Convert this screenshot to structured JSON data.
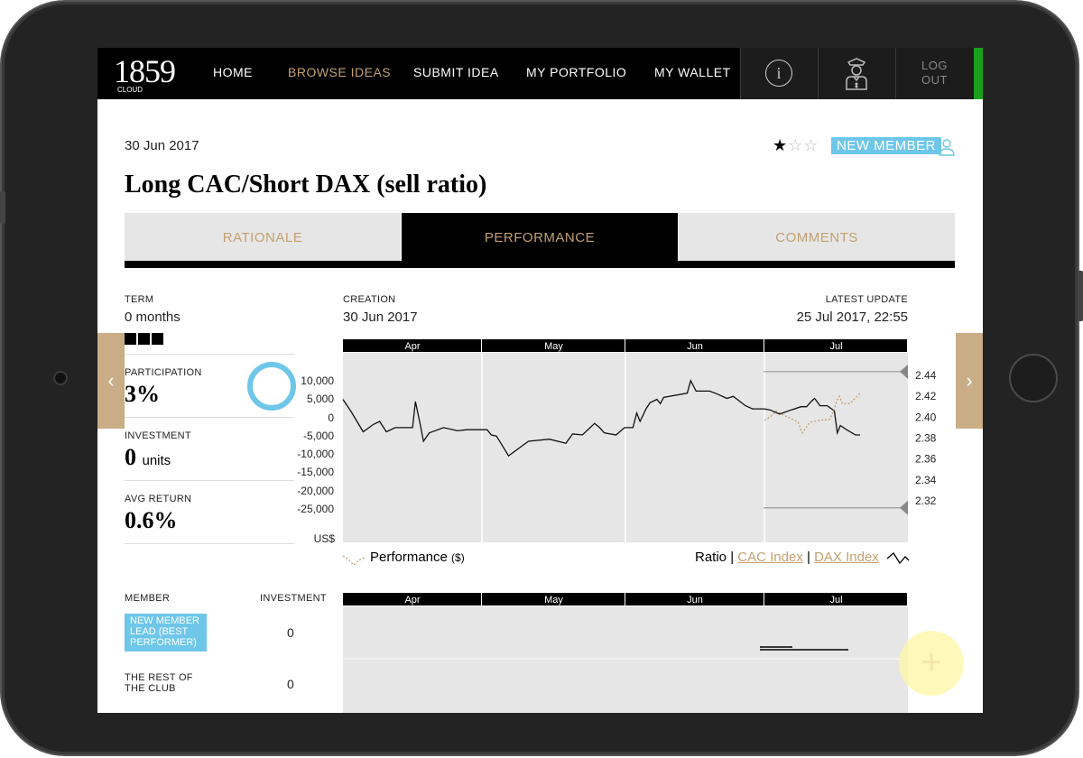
{
  "nav": {
    "logo_number": "1859",
    "logo_sub": "CLOUD",
    "links": [
      "HOME",
      "BROWSE IDEAS",
      "SUBMIT IDEA",
      "MY PORTFOLIO",
      "MY WALLET"
    ],
    "active_link": "BROWSE IDEAS",
    "info_glyph": "i",
    "logout_line1": "LOG",
    "logout_line2": "OUT"
  },
  "header": {
    "date": "30 Jun 2017",
    "title": "Long CAC/Short DAX (sell ratio)",
    "rating": 1,
    "rating_max": 3,
    "badge": "NEW MEMBER"
  },
  "tabs": {
    "items": [
      "RATIONALE",
      "PERFORMANCE",
      "COMMENTS"
    ],
    "active": "PERFORMANCE"
  },
  "stats": {
    "term_label": "TERM",
    "term_value": "0 months",
    "participation_label": "PARTICIPATION",
    "participation_value": "3%",
    "participation_fraction": 0.03,
    "investment_label": "INVESTMENT",
    "investment_value": "0",
    "investment_units": "units",
    "avg_return_label": "AVG RETURN",
    "avg_return_value": "0.6%"
  },
  "chart_info": {
    "creation_label": "CREATION",
    "creation_value": "30 Jun 2017",
    "update_label": "LATEST UPDATE",
    "update_value": "25 Jul 2017, 22:55"
  },
  "chart_data": {
    "type": "line",
    "months": [
      "Apr",
      "May",
      "Jun",
      "Jul"
    ],
    "left_ticks": [
      "10,000",
      "5,000",
      "0",
      "-5,000",
      "-10,000",
      "-15,000",
      "-20,000",
      "-25,000"
    ],
    "left_unit": "US$",
    "right_ticks": [
      "2.44",
      "2.42",
      "2.40",
      "2.38",
      "2.36",
      "2.34",
      "2.32"
    ],
    "ratio_series": [
      [
        0.0,
        2.417
      ],
      [
        0.02,
        2.405
      ],
      [
        0.048,
        2.386
      ],
      [
        0.072,
        2.393
      ],
      [
        0.087,
        2.396
      ],
      [
        0.103,
        2.386
      ],
      [
        0.124,
        2.39
      ],
      [
        0.144,
        2.39
      ],
      [
        0.154,
        2.39
      ],
      [
        0.165,
        2.39
      ],
      [
        0.172,
        2.415
      ],
      [
        0.184,
        2.392
      ],
      [
        0.191,
        2.377
      ],
      [
        0.205,
        2.385
      ],
      [
        0.239,
        2.39
      ],
      [
        0.272,
        2.387
      ],
      [
        0.293,
        2.388
      ],
      [
        0.342,
        2.388
      ],
      [
        0.352,
        2.383
      ],
      [
        0.364,
        2.382
      ],
      [
        0.375,
        2.375
      ],
      [
        0.393,
        2.363
      ],
      [
        0.44,
        2.377
      ],
      [
        0.49,
        2.379
      ],
      [
        0.529,
        2.375
      ],
      [
        0.545,
        2.384
      ],
      [
        0.568,
        2.383
      ],
      [
        0.597,
        2.394
      ],
      [
        0.609,
        2.39
      ],
      [
        0.62,
        2.385
      ],
      [
        0.648,
        2.383
      ],
      [
        0.668,
        2.39
      ],
      [
        0.688,
        2.39
      ],
      [
        0.697,
        2.404
      ],
      [
        0.705,
        2.396
      ],
      [
        0.719,
        2.408
      ],
      [
        0.729,
        2.414
      ],
      [
        0.745,
        2.417
      ],
      [
        0.753,
        2.413
      ],
      [
        0.761,
        2.419
      ],
      [
        0.817,
        2.423
      ],
      [
        0.825,
        2.435
      ],
      [
        0.838,
        2.425
      ],
      [
        0.87,
        2.425
      ],
      [
        0.889,
        2.422
      ],
      [
        0.911,
        2.418
      ],
      [
        0.926,
        2.42
      ],
      [
        0.955,
        2.411
      ],
      [
        0.972,
        2.408
      ],
      [
        0.999,
        2.408
      ],
      [
        1.013,
        2.407
      ],
      [
        1.036,
        2.403
      ],
      [
        1.064,
        2.407
      ],
      [
        1.087,
        2.41
      ],
      [
        1.1,
        2.41
      ],
      [
        1.111,
        2.415
      ],
      [
        1.119,
        2.418
      ],
      [
        1.132,
        2.411
      ],
      [
        1.149,
        2.411
      ],
      [
        1.166,
        2.406
      ],
      [
        1.173,
        2.385
      ],
      [
        1.18,
        2.392
      ],
      [
        1.195,
        2.388
      ],
      [
        1.216,
        2.383
      ],
      [
        1.227,
        2.383
      ]
    ],
    "performance_series": [
      [
        1.0,
        2.397
      ],
      [
        1.013,
        2.4
      ],
      [
        1.028,
        2.406
      ],
      [
        1.045,
        2.402
      ],
      [
        1.067,
        2.398
      ],
      [
        1.08,
        2.395
      ],
      [
        1.09,
        2.385
      ],
      [
        1.108,
        2.395
      ],
      [
        1.13,
        2.397
      ],
      [
        1.155,
        2.398
      ],
      [
        1.166,
        2.408
      ],
      [
        1.172,
        2.416
      ],
      [
        1.178,
        2.42
      ],
      [
        1.185,
        2.413
      ],
      [
        1.203,
        2.413
      ],
      [
        1.22,
        2.42
      ],
      [
        1.227,
        2.423
      ]
    ],
    "series_labels": {
      "performance": "Performance",
      "performance_unit": "($)",
      "ratio": "Ratio",
      "cac": "CAC Index",
      "dax": "DAX Index"
    },
    "legend_separator": "|"
  },
  "members": {
    "member_label": "MEMBER",
    "investment_label": "INVESTMENT",
    "rows": [
      {
        "name": "NEW MEMBER LEAD (BEST PERFORMER)",
        "value": "0"
      },
      {
        "name": "THE REST OF THE CLUB",
        "value": "0"
      }
    ]
  },
  "colors": {
    "accent_gold": "#c4a072",
    "badge_blue": "#6ec6e9",
    "status_green": "#1aa01a"
  },
  "fab_glyph": "+",
  "arrows": {
    "left": "‹",
    "right": "›"
  }
}
